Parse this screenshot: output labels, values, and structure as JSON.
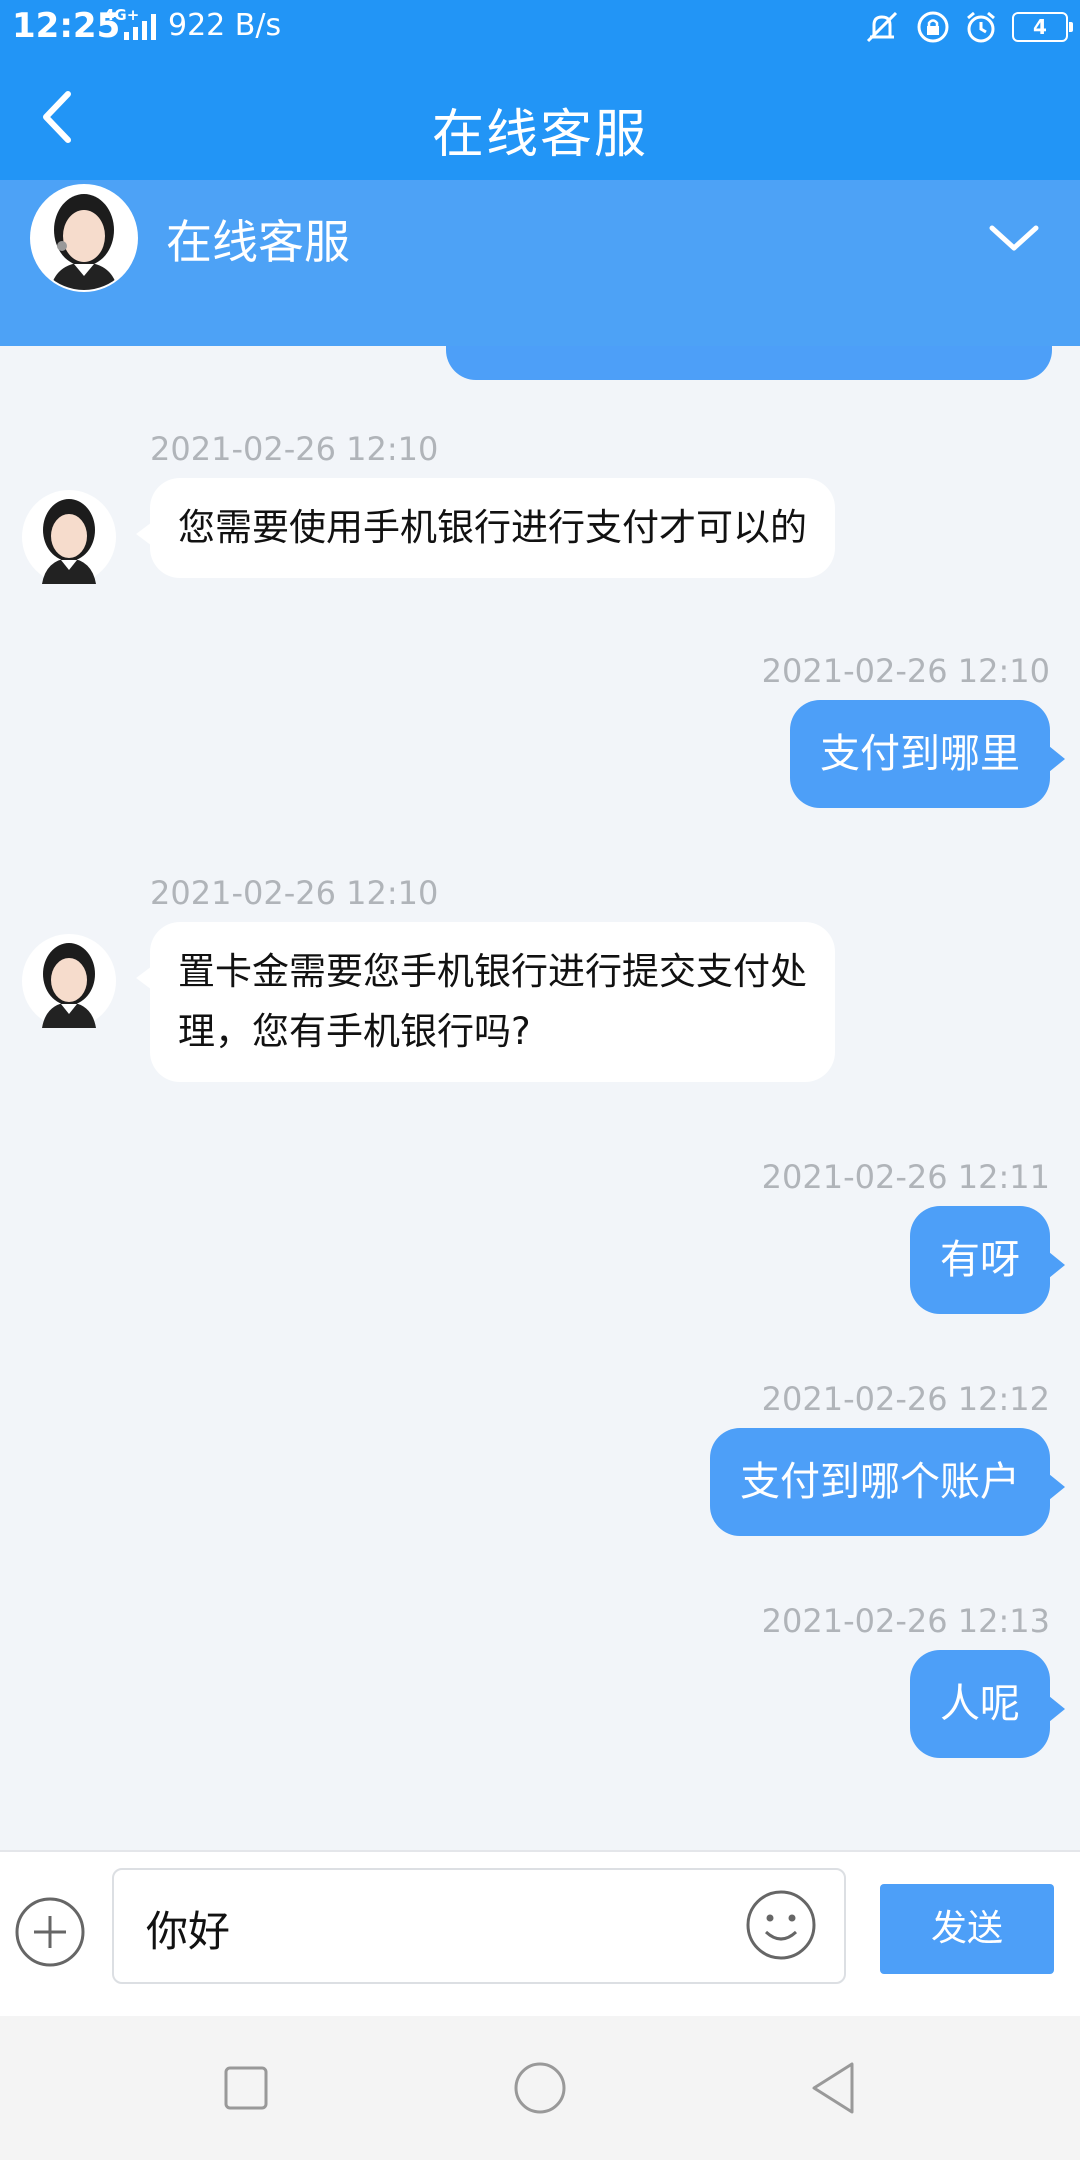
{
  "status_bar": {
    "time": "12:25",
    "network": "4G+",
    "speed": "922 B/s",
    "battery": "4"
  },
  "header": {
    "title": "在线客服"
  },
  "agent_panel": {
    "name": "在线客服"
  },
  "messages": [
    {
      "side": "in",
      "timestamp": "2021-02-26 12:10",
      "lines": [
        "您需要使用手机银行进行支付才可以的"
      ]
    },
    {
      "side": "out",
      "timestamp": "2021-02-26 12:10",
      "lines": [
        "支付到哪里"
      ]
    },
    {
      "side": "in",
      "timestamp": "2021-02-26 12:10",
      "lines": [
        "置卡金需要您手机银行进行提交支付处",
        "理，您有手机银行吗?"
      ]
    },
    {
      "side": "out",
      "timestamp": "2021-02-26 12:11",
      "lines": [
        "有呀"
      ]
    },
    {
      "side": "out",
      "timestamp": "2021-02-26 12:12",
      "lines": [
        "支付到哪个账户"
      ]
    },
    {
      "side": "out",
      "timestamp": "2021-02-26 12:13",
      "lines": [
        "人呢"
      ]
    }
  ],
  "input_bar": {
    "value": "你好",
    "send_label": "发送"
  },
  "colors": {
    "primary": "#2295f6",
    "bubble_out": "#4d9ff8",
    "background": "#f2f5f9"
  },
  "icons": [
    "back-arrow-icon",
    "chevron-down-icon",
    "plus-icon",
    "emoji-icon",
    "recents-icon",
    "home-icon",
    "back-nav-icon"
  ]
}
